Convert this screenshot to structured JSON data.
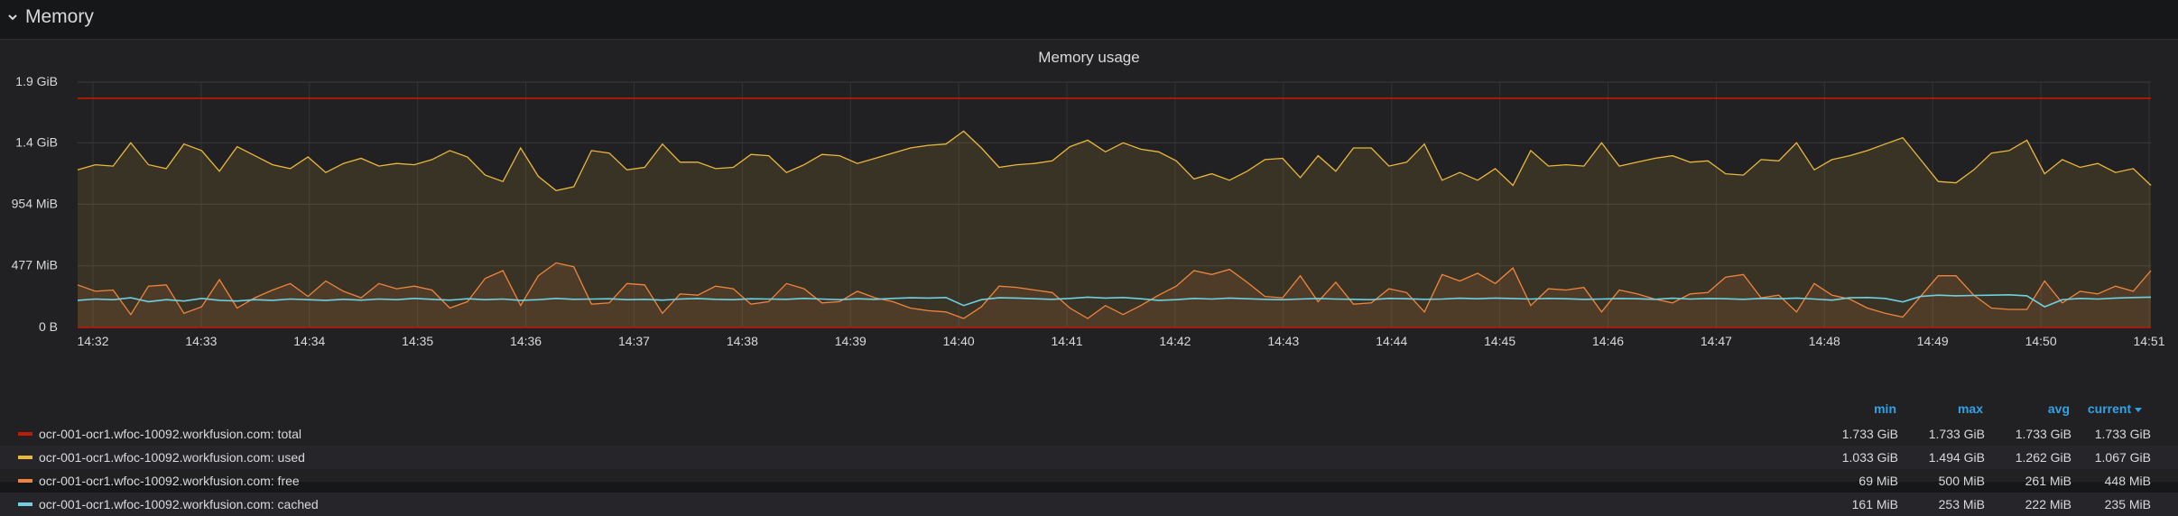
{
  "row": {
    "title": "Memory",
    "chevron_icon": "chevron-down-icon"
  },
  "panel": {
    "title": "Memory usage"
  },
  "legend": {
    "columns": {
      "min": "min",
      "max": "max",
      "avg": "avg",
      "current": "current"
    },
    "sort_icon": "sort-desc-icon",
    "rows": [
      {
        "name": "ocr-001-ocr1.wfoc-10092.workfusion.com: total",
        "color": "#bf1b00",
        "min": "1.733 GiB",
        "max": "1.733 GiB",
        "avg": "1.733 GiB",
        "current": "1.733 GiB"
      },
      {
        "name": "ocr-001-ocr1.wfoc-10092.workfusion.com: used",
        "color": "#eab839",
        "min": "1.033 GiB",
        "max": "1.494 GiB",
        "avg": "1.262 GiB",
        "current": "1.067 GiB"
      },
      {
        "name": "ocr-001-ocr1.wfoc-10092.workfusion.com: free",
        "color": "#ef843c",
        "min": "69 MiB",
        "max": "500 MiB",
        "avg": "261 MiB",
        "current": "448 MiB"
      },
      {
        "name": "ocr-001-ocr1.wfoc-10092.workfusion.com: cached",
        "color": "#6ed0e0",
        "min": "161 MiB",
        "max": "253 MiB",
        "avg": "222 MiB",
        "current": "235 MiB"
      }
    ]
  },
  "chart_data": {
    "type": "area",
    "title": "Memory usage",
    "y_unit": "MiB",
    "ylim": [
      0,
      1900
    ],
    "y_ticks": [
      {
        "value": 1900,
        "label": "1.9 GiB"
      },
      {
        "value": 1430,
        "label": "1.4 GiB"
      },
      {
        "value": 954,
        "label": "954 MiB"
      },
      {
        "value": 477,
        "label": "477 MiB"
      },
      {
        "value": 0,
        "label": "0 B"
      }
    ],
    "x_ticks": [
      "14:32",
      "14:33",
      "14:34",
      "14:35",
      "14:36",
      "14:37",
      "14:38",
      "14:39",
      "14:40",
      "14:41",
      "14:42",
      "14:43",
      "14:44",
      "14:45",
      "14:46",
      "14:47",
      "14:48",
      "14:49",
      "14:50",
      "14:51"
    ],
    "grid": true,
    "legend_placement": "bottom",
    "series": [
      {
        "name": "ocr-001-ocr1.wfoc-10092.workfusion.com: total",
        "color": "#bf1b00",
        "fill": false,
        "values": [
          1775,
          1775,
          1775,
          1775,
          1775,
          1775,
          1775,
          1775,
          1775,
          1775,
          1775,
          1775,
          1775,
          1775,
          1775,
          1775,
          1775,
          1775,
          1775,
          1775,
          1775,
          1775,
          1775,
          1775,
          1775,
          1775,
          1775,
          1775,
          1775,
          1775,
          1775,
          1775,
          1775,
          1775,
          1775,
          1775,
          1775,
          1775,
          1775,
          1775,
          1775,
          1775,
          1775,
          1775,
          1775,
          1775,
          1775,
          1775,
          1775,
          1775,
          1775,
          1775,
          1775,
          1775,
          1775,
          1775,
          1775,
          1775,
          1775,
          1775,
          1775,
          1775,
          1775,
          1775,
          1775,
          1775,
          1775,
          1775,
          1775,
          1775,
          1775,
          1775,
          1775,
          1775,
          1775,
          1775,
          1775,
          1775,
          1775,
          1775,
          1775,
          1775,
          1775,
          1775,
          1775,
          1775,
          1775,
          1775,
          1775,
          1775,
          1775,
          1775,
          1775,
          1775,
          1775,
          1775,
          1775,
          1775,
          1775,
          1775,
          1775,
          1775,
          1775,
          1775,
          1775,
          1775,
          1775,
          1775,
          1775,
          1775,
          1775,
          1775,
          1775,
          1775,
          1775,
          1775,
          1775,
          1775,
          1775,
          1775,
          1775,
          1775,
          1775,
          1775,
          1775
        ]
      },
      {
        "name": "ocr-001-ocr1.wfoc-10092.workfusion.com: used",
        "color": "#eab839",
        "fill": true,
        "values": [
          1220,
          1260,
          1250,
          1430,
          1260,
          1230,
          1420,
          1370,
          1210,
          1400,
          1330,
          1260,
          1230,
          1320,
          1200,
          1270,
          1310,
          1250,
          1270,
          1260,
          1300,
          1370,
          1320,
          1180,
          1130,
          1390,
          1170,
          1060,
          1090,
          1370,
          1350,
          1220,
          1240,
          1420,
          1280,
          1280,
          1230,
          1240,
          1340,
          1330,
          1200,
          1260,
          1340,
          1330,
          1270,
          1310,
          1350,
          1390,
          1410,
          1420,
          1520,
          1390,
          1240,
          1260,
          1270,
          1290,
          1400,
          1450,
          1360,
          1430,
          1380,
          1360,
          1290,
          1150,
          1190,
          1140,
          1210,
          1300,
          1310,
          1160,
          1330,
          1210,
          1390,
          1390,
          1250,
          1280,
          1420,
          1140,
          1200,
          1140,
          1230,
          1100,
          1370,
          1250,
          1260,
          1250,
          1430,
          1250,
          1280,
          1310,
          1330,
          1280,
          1290,
          1190,
          1180,
          1300,
          1290,
          1430,
          1220,
          1300,
          1330,
          1370,
          1420,
          1470,
          1300,
          1130,
          1120,
          1220,
          1350,
          1370,
          1450,
          1190,
          1300,
          1240,
          1270,
          1200,
          1230,
          1100
        ]
      },
      {
        "name": "ocr-001-ocr1.wfoc-10092.workfusion.com: free",
        "color": "#ef843c",
        "fill": true,
        "values": [
          330,
          280,
          290,
          100,
          320,
          330,
          110,
          160,
          370,
          150,
          230,
          290,
          340,
          240,
          360,
          280,
          230,
          340,
          300,
          320,
          290,
          150,
          200,
          380,
          440,
          170,
          400,
          500,
          470,
          180,
          190,
          340,
          330,
          110,
          260,
          250,
          320,
          300,
          180,
          200,
          340,
          300,
          190,
          200,
          280,
          230,
          200,
          150,
          130,
          120,
          70,
          160,
          320,
          310,
          290,
          270,
          150,
          70,
          170,
          100,
          170,
          250,
          320,
          440,
          410,
          450,
          350,
          240,
          230,
          400,
          200,
          350,
          180,
          190,
          300,
          270,
          120,
          410,
          360,
          420,
          340,
          460,
          170,
          300,
          290,
          310,
          120,
          290,
          260,
          220,
          190,
          260,
          270,
          390,
          410,
          230,
          250,
          120,
          340,
          250,
          220,
          150,
          110,
          80,
          240,
          400,
          400,
          250,
          150,
          140,
          140,
          360,
          190,
          280,
          260,
          320,
          280,
          440
        ]
      },
      {
        "name": "ocr-001-ocr1.wfoc-10092.workfusion.com: cached",
        "color": "#6ed0e0",
        "fill": false,
        "values": [
          210,
          220,
          215,
          230,
          200,
          215,
          205,
          225,
          210,
          205,
          215,
          210,
          220,
          215,
          210,
          218,
          212,
          220,
          215,
          225,
          218,
          212,
          222,
          215,
          220,
          210,
          215,
          225,
          218,
          220,
          222,
          215,
          218,
          212,
          220,
          224,
          218,
          215,
          222,
          220,
          218,
          225,
          220,
          215,
          222,
          218,
          225,
          230,
          228,
          232,
          170,
          215,
          230,
          228,
          222,
          218,
          225,
          235,
          228,
          232,
          222,
          210,
          215,
          225,
          220,
          228,
          222,
          218,
          215,
          220,
          224,
          220,
          218,
          215,
          225,
          222,
          218,
          220,
          226,
          222,
          228,
          224,
          220,
          225,
          222,
          218,
          220,
          224,
          222,
          218,
          226,
          220,
          224,
          222,
          218,
          225,
          222,
          228,
          220,
          212,
          230,
          232,
          225,
          198,
          240,
          250,
          245,
          248,
          250,
          253,
          245,
          160,
          215,
          225,
          220,
          228,
          232,
          235
        ]
      }
    ]
  }
}
